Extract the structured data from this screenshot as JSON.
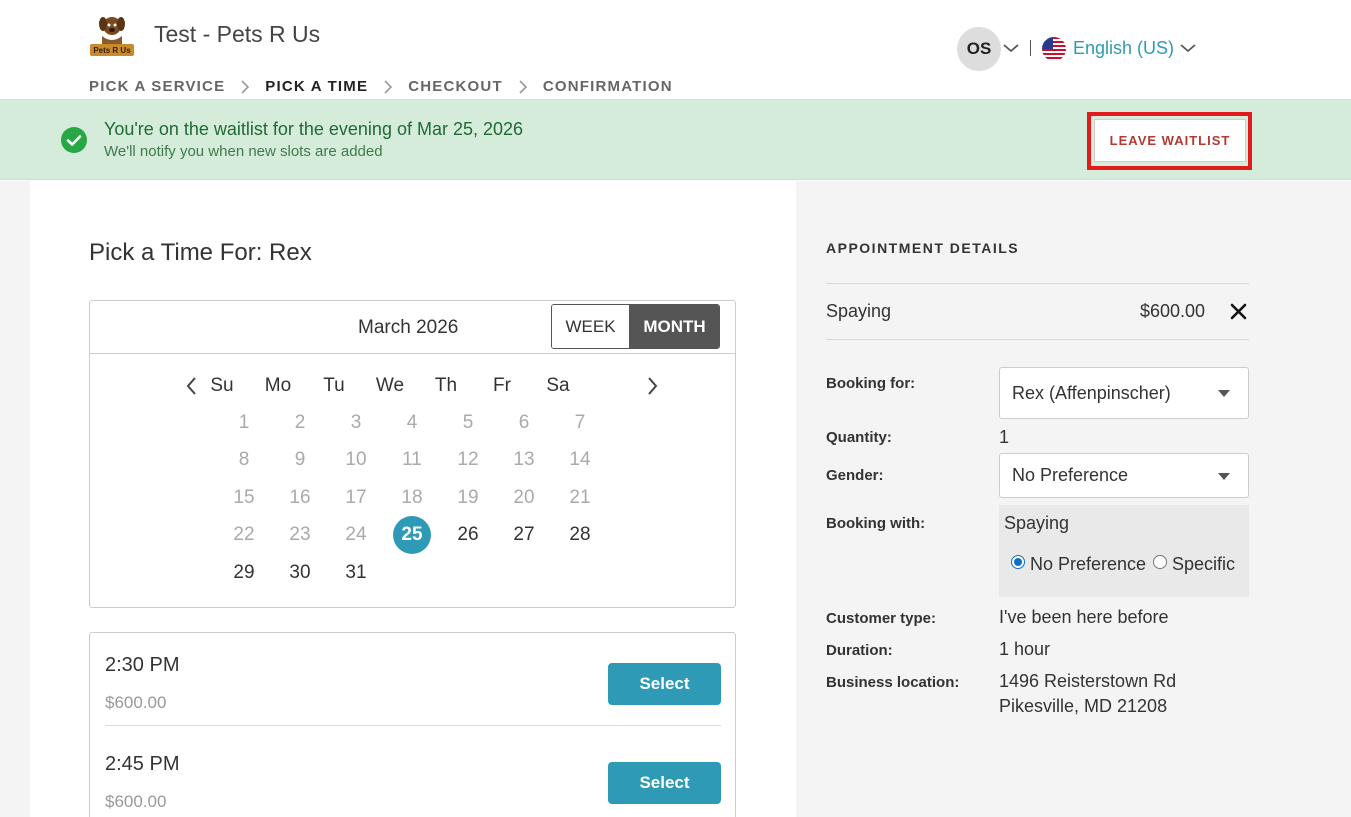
{
  "header": {
    "business_name": "Test - Pets R Us",
    "logo_text": "Pets R Us",
    "steps": [
      {
        "label": "PICK A SERVICE",
        "active": false
      },
      {
        "label": "PICK A TIME",
        "active": true
      },
      {
        "label": "CHECKOUT",
        "active": false
      },
      {
        "label": "CONFIRMATION",
        "active": false
      }
    ],
    "user_initials": "OS",
    "language": "English (US)"
  },
  "banner": {
    "title": "You're on the waitlist for the evening of Mar 25, 2026",
    "subtitle": "We'll notify you when new slots are added",
    "leave_label": "LEAVE WAITLIST"
  },
  "picker": {
    "heading": "Pick a Time For: Rex",
    "month_label": "March 2026",
    "view_week": "WEEK",
    "view_month": "MONTH",
    "weekdays": [
      "Su",
      "Mo",
      "Tu",
      "We",
      "Th",
      "Fr",
      "Sa"
    ],
    "first_weekday_index": 0,
    "days_in_month": 31,
    "selected_day": 25,
    "first_available_day": 25
  },
  "slots": [
    {
      "time": "2:30 PM",
      "price": "$600.00",
      "button": "Select"
    },
    {
      "time": "2:45 PM",
      "price": "$600.00",
      "button": "Select"
    }
  ],
  "details": {
    "title": "APPOINTMENT DETAILS",
    "service": {
      "name": "Spaying",
      "price": "$600.00"
    },
    "booking_for_label": "Booking for:",
    "booking_for_value": "Rex (Affenpinscher)",
    "quantity_label": "Quantity:",
    "quantity_value": "1",
    "gender_label": "Gender:",
    "gender_value": "No Preference",
    "booking_with_label": "Booking with:",
    "booking_with_service": "Spaying",
    "booking_with_options": [
      "No Preference",
      "Specific"
    ],
    "booking_with_selected": "No Preference",
    "customer_type_label": "Customer type:",
    "customer_type_value": "I've been here before",
    "duration_label": "Duration:",
    "duration_value": "1 hour",
    "location_label": "Business location:",
    "location_line1": "1496 Reisterstown Rd",
    "location_line2": "Pikesville, MD 21208"
  },
  "colors": {
    "accent": "#2e9ab5",
    "banner_bg": "#d5ecdb",
    "banner_text": "#1e6b33",
    "success": "#28a745",
    "leave_text": "#b23a32",
    "highlight_outline": "#e01b1b"
  }
}
